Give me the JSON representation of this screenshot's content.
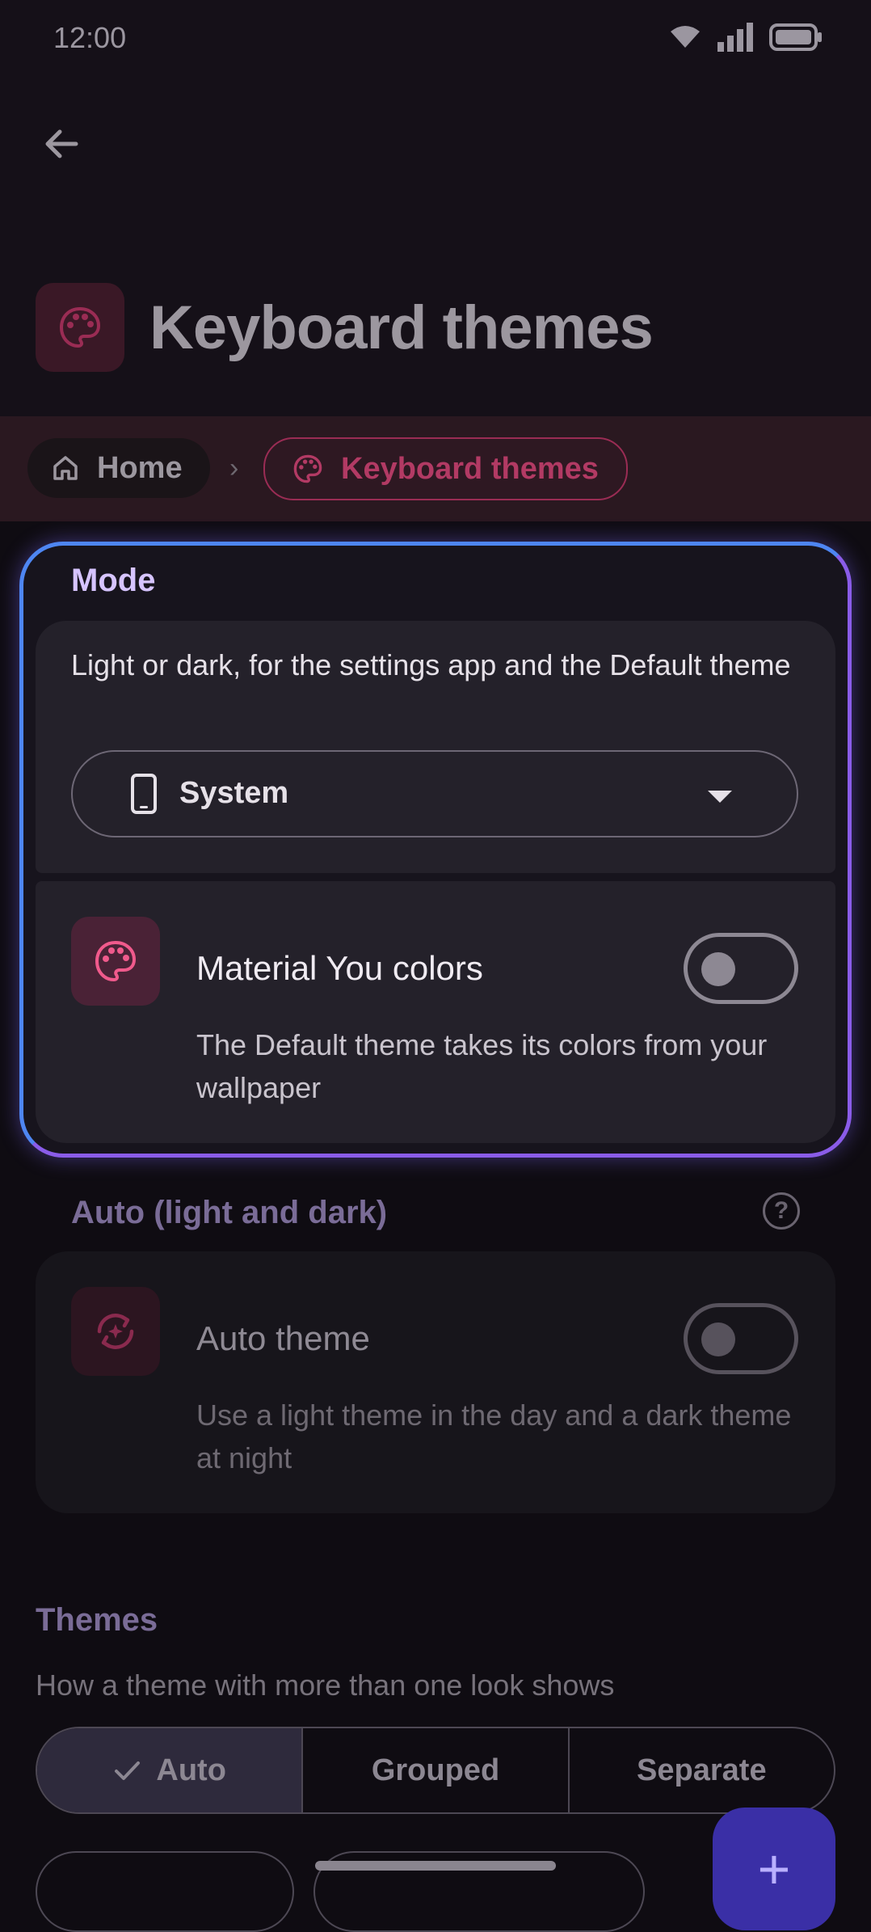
{
  "status_bar": {
    "time": "12:00"
  },
  "header": {
    "title": "Keyboard themes"
  },
  "breadcrumb": {
    "home": "Home",
    "separator": "›",
    "current": "Keyboard themes"
  },
  "mode": {
    "label": "Mode",
    "description": "Light or dark, for the settings app and the Default theme",
    "select_value": "System",
    "material_you": {
      "title": "Material You colors",
      "description": "The Default theme takes its colors from your wallpaper",
      "enabled": false
    }
  },
  "auto": {
    "label": "Auto (light and dark)",
    "help": "?",
    "auto_theme": {
      "title": "Auto theme",
      "description": "Use a light theme in the day and a dark theme at night",
      "enabled": false
    }
  },
  "themes": {
    "label": "Themes",
    "description": "How a theme with more than one look shows",
    "segments": [
      "Auto",
      "Grouped",
      "Separate"
    ],
    "selected": "Auto",
    "fab": "+"
  },
  "colors": {
    "accent": "#b23a64",
    "highlight_border": "#4e86f2",
    "fab": "#3a2fa6"
  }
}
